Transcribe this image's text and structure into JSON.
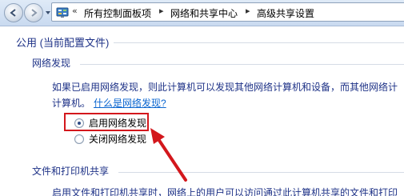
{
  "address_bar": {
    "breadcrumbs": [
      "所有控制面板项",
      "网络和共享中心",
      "高级共享设置"
    ],
    "separator": "▸",
    "overflow": "«"
  },
  "profile": {
    "title": "公用 (当前配置文件)"
  },
  "network_discovery": {
    "heading": "网络发现",
    "description_line1": "如果已启用网络发现，则此计算机可以发现其他网络计算机和设备，而其他网络计",
    "description_line2": "计算机。",
    "help_link": "什么是网络发现?",
    "options": [
      {
        "label": "启用网络发现",
        "selected": true
      },
      {
        "label": "关闭网络发现",
        "selected": false
      }
    ]
  },
  "file_printer_sharing": {
    "heading": "文件和打印机共享",
    "description": "启用文件和打印机共享时，网络上的用户可以访问通过此计算机共享的文件和打印"
  },
  "annotation": {
    "highlight_color": "#d3171c"
  },
  "icons": [
    "back-arrow-icon",
    "forward-arrow-icon",
    "history-dropdown-icon",
    "control-panel-icon"
  ]
}
